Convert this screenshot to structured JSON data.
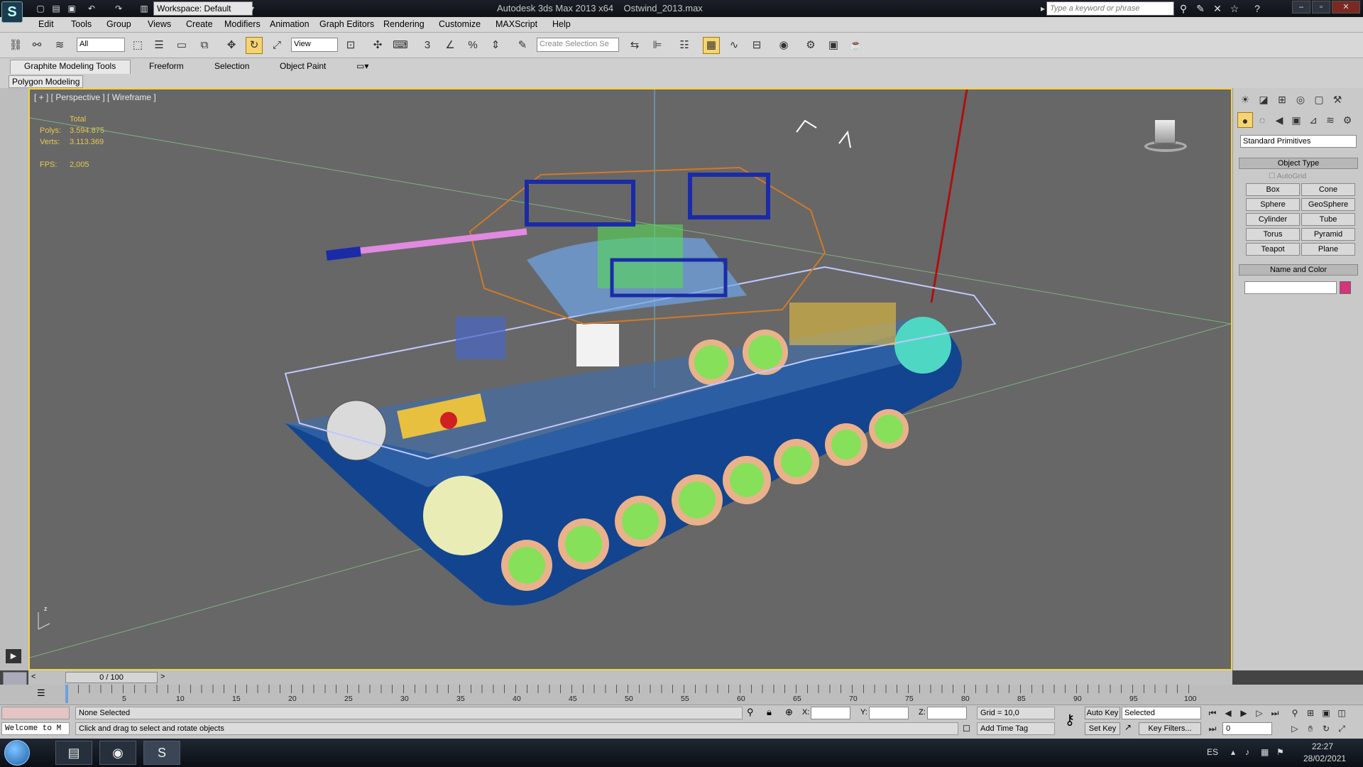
{
  "title_bar": {
    "app": "Autodesk 3ds Max  2013 x64",
    "file": "Ostwind_2013.max",
    "workspace": "Workspace: Default",
    "search_placeholder": "Type a keyword or phrase",
    "logo": "S"
  },
  "menu": [
    "Edit",
    "Tools",
    "Group",
    "Views",
    "Create",
    "Modifiers",
    "Animation",
    "Graph Editors",
    "Rendering",
    "Customize",
    "MAXScript",
    "Help"
  ],
  "toolbar": {
    "selection_filter": "All",
    "ref_coord": "View",
    "named_selection": "Create Selection Se",
    "snap_label": "3"
  },
  "ribbon": {
    "tabs": [
      "Graphite Modeling Tools",
      "Freeform",
      "Selection",
      "Object Paint"
    ],
    "active_tab": "Graphite Modeling Tools",
    "panel": "Polygon Modeling"
  },
  "viewport": {
    "label": "[ + ] [ Perspective ] [ Wireframe ]",
    "stats": {
      "header": "Total",
      "polys_label": "Polys:",
      "polys": "3.594.875",
      "verts_label": "Verts:",
      "verts": "3.113.369",
      "fps_label": "FPS:",
      "fps": "2,005"
    }
  },
  "command_panel": {
    "category": "Standard Primitives",
    "object_type": "Object Type",
    "autogrid": "AutoGrid",
    "primitives": [
      "Box",
      "Cone",
      "Sphere",
      "GeoSphere",
      "Cylinder",
      "Tube",
      "Torus",
      "Pyramid",
      "Teapot",
      "Plane"
    ],
    "name_color": "Name and Color",
    "color": "#d6337a"
  },
  "timeline": {
    "frame": "0 / 100",
    "ticks": [
      "5",
      "10",
      "15",
      "20",
      "25",
      "30",
      "35",
      "40",
      "45",
      "50",
      "55",
      "60",
      "65",
      "70",
      "75",
      "80",
      "85",
      "90",
      "95",
      "100"
    ]
  },
  "status": {
    "selection": "None Selected",
    "prompt": "Click and drag to select and rotate objects",
    "maxscript": "Welcome to M",
    "x_label": "X:",
    "y_label": "Y:",
    "z_label": "Z:",
    "grid": "Grid = 10,0",
    "auto_key": "Auto Key",
    "key_mode": "Selected",
    "set_key": "Set Key",
    "key_filters": "Key Filters...",
    "add_time_tag": "Add Time Tag",
    "current_frame": "0"
  },
  "taskbar": {
    "lang": "ES",
    "time": "22:27",
    "date": "28/02/2021"
  }
}
